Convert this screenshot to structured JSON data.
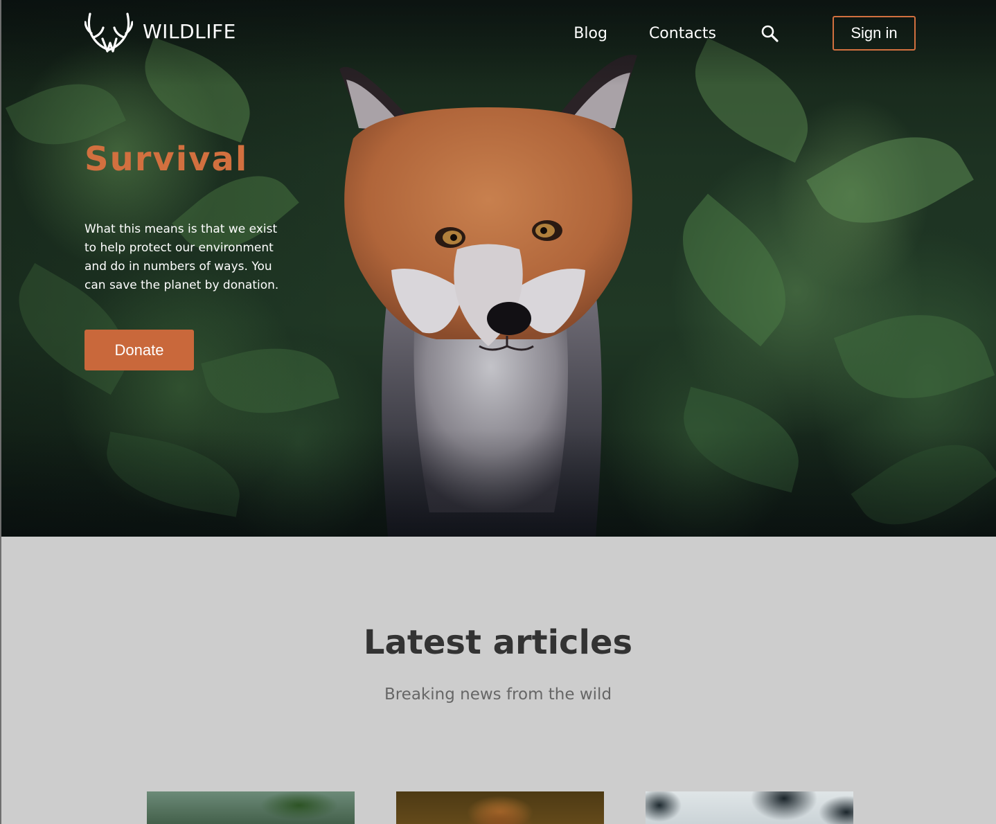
{
  "header": {
    "logo_text": "WILDLIFE",
    "logo_icon": "antlers-icon",
    "nav": {
      "blog": "Blog",
      "contacts": "Contacts",
      "search_icon": "search-icon",
      "sign_in": "Sign in"
    }
  },
  "hero": {
    "title": "Survival",
    "text": "What this means is that we exist to help protect our environment and do in numbers of ways. You can save the planet by donation.",
    "donate_label": "Donate",
    "image": "fox-photo"
  },
  "articles": {
    "title": "Latest articles",
    "subtitle": "Breaking news from the wild",
    "thumbnails": [
      "article-thumbnail-forest",
      "article-thumbnail-animal",
      "article-thumbnail-snow"
    ]
  },
  "colors": {
    "accent": "#d2703f",
    "button": "#c9683b",
    "section_bg": "#cdcdcd",
    "heading": "#333333",
    "subheading": "#666666"
  }
}
